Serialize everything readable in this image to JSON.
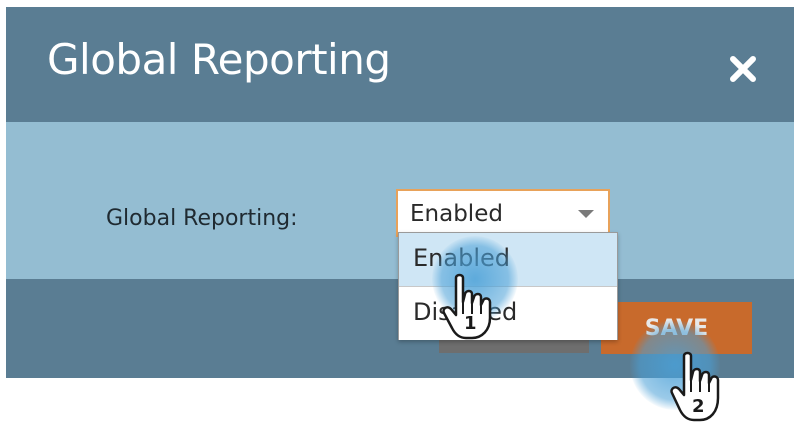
{
  "dialog": {
    "title": "Global Reporting",
    "close_icon": "close-icon"
  },
  "form": {
    "label": "Global Reporting:",
    "select_value": "Enabled",
    "caret_icon": "chevron-down-icon"
  },
  "dropdown": {
    "options": [
      "Enabled",
      "Disabled"
    ],
    "highlighted": "Enabled"
  },
  "footer": {
    "save_label": "SAVE"
  },
  "annotations": {
    "step1": "1",
    "step2": "2",
    "pointer_icon": "hand-pointer-icon"
  },
  "colors": {
    "header": "#5a7d93",
    "body": "#94bdd2",
    "save_button": "#c86a2c",
    "select_border": "#e8a25a",
    "highlight": "#cfe6f5"
  }
}
